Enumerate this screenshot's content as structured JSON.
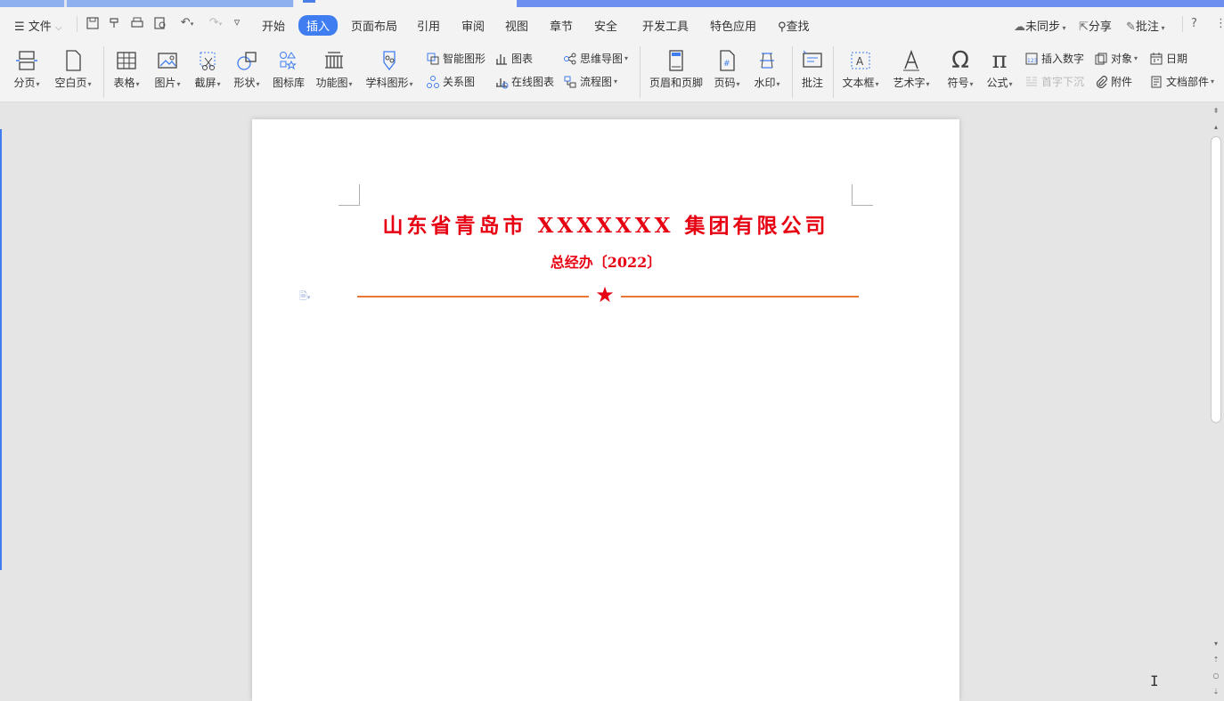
{
  "menu": {
    "file_label": "文件",
    "tabs": [
      "开始",
      "插入",
      "页面布局",
      "引用",
      "审阅",
      "视图",
      "章节",
      "安全",
      "开发工具",
      "特色应用"
    ],
    "active_tab": "插入",
    "search_label": "查找",
    "sync_label": "未同步",
    "share_label": "分享",
    "comment_label": "批注",
    "help_label": "?"
  },
  "ribbon": {
    "page_break": "分页",
    "blank_page": "空白页",
    "table": "表格",
    "picture": "图片",
    "screenshot": "截屏",
    "shapes": "形状",
    "icon_lib": "图标库",
    "func_chart": "功能图",
    "science_shape": "学科图形",
    "smart_shape": "智能图形",
    "relation_chart": "关系图",
    "chart": "图表",
    "online_chart": "在线图表",
    "mind_map": "思维导图",
    "flow_chart": "流程图",
    "header_footer": "页眉和页脚",
    "page_number": "页码",
    "watermark": "水印",
    "comment": "批注",
    "text_box": "文本框",
    "word_art": "艺术字",
    "symbol": "符号",
    "formula": "公式",
    "insert_number": "插入数字",
    "drop_cap": "首字下沉",
    "object": "对象",
    "attachment": "附件",
    "date": "日期",
    "doc_parts": "文档部件"
  },
  "document": {
    "title": "山东省青岛市 XXXXXXX 集团有限公司",
    "subtitle": "总经办〔2022〕",
    "star": "★"
  },
  "colors": {
    "accent": "#3f7df0",
    "red_header": "#e60012",
    "red_line": "#e97632"
  }
}
